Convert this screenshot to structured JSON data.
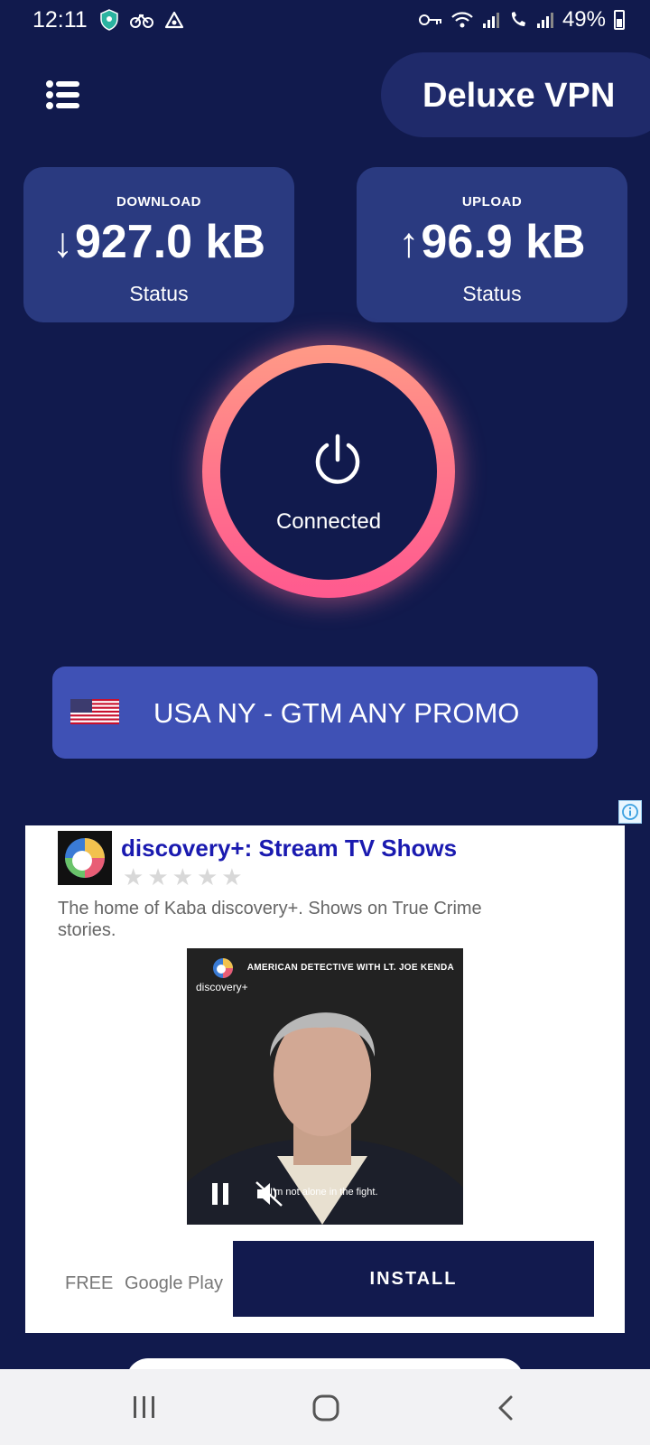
{
  "status_bar": {
    "time": "12:11",
    "battery": "49%"
  },
  "header": {
    "app_title": "Deluxe VPN"
  },
  "stats": {
    "download": {
      "label": "DOWNLOAD",
      "value": "927.0 kB",
      "status": "Status"
    },
    "upload": {
      "label": "UPLOAD",
      "value": "96.9 kB",
      "status": "Status"
    }
  },
  "power": {
    "state_label": "Connected"
  },
  "server": {
    "label": "USA NY - GTM ANY PROMO",
    "flag": "us-flag"
  },
  "ad": {
    "title": "discovery+: Stream TV Shows",
    "description": "The home of Kaba discovery+. Shows on True Crime stories.",
    "video_brand": "discovery+",
    "video_caption": "AMERICAN DETECTIVE WITH LT. JOE KENDA",
    "video_subtitle": "I'm not alone in the fight.",
    "price": "FREE",
    "store": "Google Play",
    "install_label": "INSTALL"
  },
  "colors": {
    "background": "#111a4d",
    "card": "#2a3a80",
    "server_button": "#3f51b5",
    "ring": "#ff6f8c",
    "ad_title": "#1a1ab0"
  }
}
